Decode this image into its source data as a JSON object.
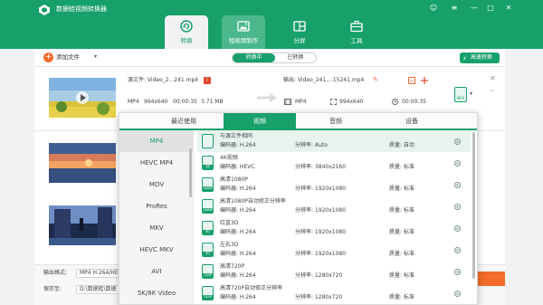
{
  "app": {
    "title": "数据蛙视频转换器"
  },
  "window_controls": {
    "chat": "☺",
    "menu": "≡",
    "minimize": "—",
    "maximize": "□",
    "close": "✕"
  },
  "main_tabs": [
    {
      "label": "转换",
      "icon": "convert-icon",
      "active": true
    },
    {
      "label": "短视频制作",
      "icon": "image-icon",
      "active": false
    },
    {
      "label": "分屏",
      "icon": "split-screen-icon",
      "active": false
    },
    {
      "label": "工具",
      "icon": "toolbox-icon",
      "active": false
    }
  ],
  "toolbar": {
    "add_file_label": "添加文件",
    "add_icon": "+",
    "caret": "▾",
    "segment": {
      "converting": "转换中",
      "converted": "已转换"
    },
    "fast_convert_label": "高速转换",
    "fast_convert_icon": "⚡"
  },
  "file_item": {
    "source_label": "源文件: Video_2...241.mp4",
    "output_label": "输出: Video_241....15241.mp4",
    "source": {
      "format": "MP4",
      "resolution": "994x640",
      "duration": "00:00:35",
      "size": "3.71 MB"
    },
    "output": {
      "format": "MP4",
      "resolution": "994x640",
      "duration": "00:00:35"
    },
    "badge_text": "MP4",
    "close": "✕",
    "expand": "⌄",
    "info_glyph": "i",
    "edit_glyph": "✎",
    "cut_glyph": "✂",
    "caret": "▾"
  },
  "bottom_bar": {
    "output_format_label": "输出格式:",
    "output_format_value": "MP4 H.264/HE",
    "save_to_label": "保存至:",
    "save_to_value": "D:\\数据蛙\\数据"
  },
  "format_panel": {
    "tabs": [
      {
        "label": "最近使用",
        "active": false
      },
      {
        "label": "视频",
        "active": true
      },
      {
        "label": "音频",
        "active": false
      },
      {
        "label": "设备",
        "active": false
      }
    ],
    "formats": [
      {
        "label": "MP4",
        "active": true
      },
      {
        "label": "HEVC MP4",
        "active": false
      },
      {
        "label": "MOV",
        "active": false
      },
      {
        "label": "ProRes",
        "active": false
      },
      {
        "label": "MKV",
        "active": false
      },
      {
        "label": "HEVC MKV",
        "active": false
      },
      {
        "label": "AVI",
        "active": false
      },
      {
        "label": "5K/8K Video",
        "active": false
      }
    ],
    "presets": [
      {
        "title": "与源文件相同",
        "encoder": "编码器: H.264",
        "resolution": "分辨率: Auto",
        "quality": "质量: 自动",
        "icon_label": "",
        "active": true
      },
      {
        "title": "4K视频",
        "encoder": "编码器: HEVC",
        "resolution": "分辨率: 3840x2160",
        "quality": "质量: 标准",
        "icon_label": "4K",
        "active": false
      },
      {
        "title": "高清1080P",
        "encoder": "编码器: H.264",
        "resolution": "分辨率: 1920x1080",
        "quality": "质量: 标准",
        "icon_label": "1080P",
        "active": false
      },
      {
        "title": "高清1080P自动修正分辨率",
        "encoder": "编码器: H.264",
        "resolution": "分辨率: 1920x1080",
        "quality": "质量: 标准",
        "icon_label": "1080P",
        "active": false
      },
      {
        "title": "红蓝3D",
        "encoder": "编码器: H.264",
        "resolution": "分辨率: 1920x1080",
        "quality": "质量: 标准",
        "icon_label": "3D",
        "active": false
      },
      {
        "title": "左右3D",
        "encoder": "编码器: H.264",
        "resolution": "分辨率: 1920x1080",
        "quality": "质量: 标准",
        "icon_label": "3D",
        "active": false
      },
      {
        "title": "高清720P",
        "encoder": "编码器: H.264",
        "resolution": "分辨率: 1280x720",
        "quality": "质量: 标准",
        "icon_label": "720P",
        "active": false
      },
      {
        "title": "高清720P自动修正分辨率",
        "encoder": "编码器: H.264",
        "resolution": "分辨率: 1280x720",
        "quality": "质量: 标准",
        "icon_label": "720P",
        "active": false
      }
    ]
  },
  "colors": {
    "brand": "#18a06a",
    "accent": "#f26b2a",
    "info": "#e0492b"
  }
}
